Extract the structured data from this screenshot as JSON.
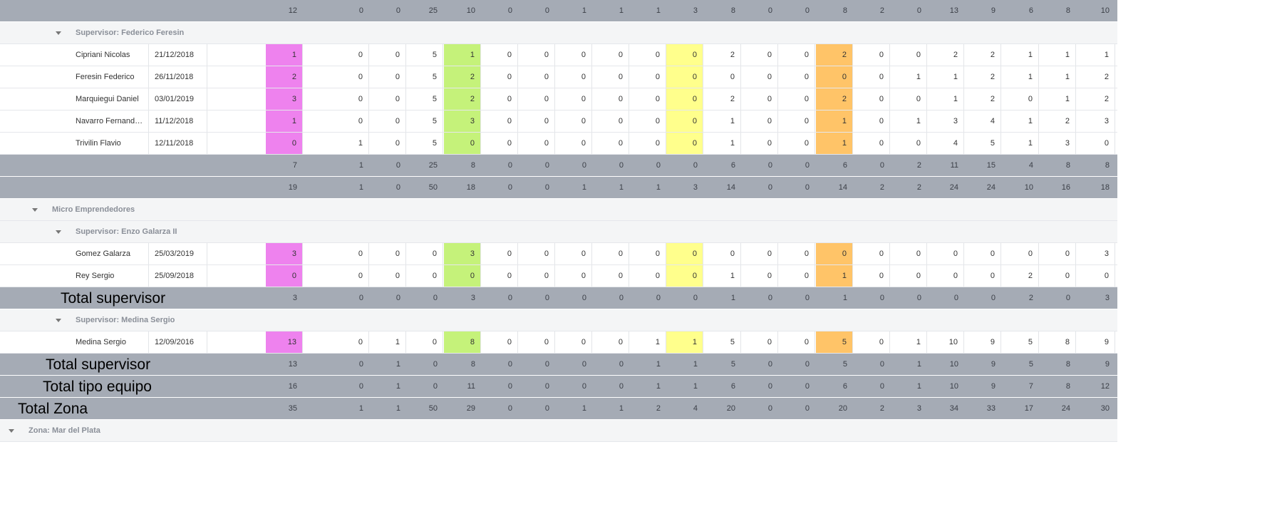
{
  "rows": [
    {
      "type": "total",
      "values": [
        "12",
        "0",
        "0",
        "25",
        "10",
        "0",
        "0",
        "1",
        "1",
        "1",
        "3",
        "8",
        "0",
        "0",
        "8",
        "2",
        "0",
        "13",
        "9",
        "6",
        "8",
        "10"
      ]
    },
    {
      "type": "group",
      "level": 2,
      "label": "Supervisor: Federico Feresin"
    },
    {
      "type": "data",
      "name": "Cipriani Nicolas",
      "date": "21/12/2018",
      "values": [
        "1",
        "0",
        "0",
        "5",
        "1",
        "0",
        "0",
        "0",
        "0",
        "0",
        "0",
        "2",
        "0",
        "0",
        "2",
        "0",
        "0",
        "2",
        "2",
        "1",
        "1",
        "1"
      ]
    },
    {
      "type": "data",
      "name": "Feresin Federico",
      "date": "26/11/2018",
      "values": [
        "2",
        "0",
        "0",
        "5",
        "2",
        "0",
        "0",
        "0",
        "0",
        "0",
        "0",
        "0",
        "0",
        "0",
        "0",
        "0",
        "1",
        "1",
        "2",
        "1",
        "1",
        "2"
      ]
    },
    {
      "type": "data",
      "name": "Marquiegui Daniel",
      "date": "03/01/2019",
      "values": [
        "3",
        "0",
        "0",
        "5",
        "2",
        "0",
        "0",
        "0",
        "0",
        "0",
        "0",
        "2",
        "0",
        "0",
        "2",
        "0",
        "0",
        "1",
        "2",
        "0",
        "1",
        "2"
      ]
    },
    {
      "type": "data",
      "name": "Navarro Fernando F...",
      "date": "11/12/2018",
      "values": [
        "1",
        "0",
        "0",
        "5",
        "3",
        "0",
        "0",
        "0",
        "0",
        "0",
        "0",
        "1",
        "0",
        "0",
        "1",
        "0",
        "1",
        "3",
        "4",
        "1",
        "2",
        "3"
      ]
    },
    {
      "type": "data",
      "name": "Trivilin Flavio",
      "date": "12/11/2018",
      "values": [
        "0",
        "1",
        "0",
        "5",
        "0",
        "0",
        "0",
        "0",
        "0",
        "0",
        "0",
        "1",
        "0",
        "0",
        "1",
        "0",
        "0",
        "4",
        "5",
        "1",
        "3",
        "0"
      ]
    },
    {
      "type": "total",
      "values": [
        "7",
        "1",
        "0",
        "25",
        "8",
        "0",
        "0",
        "0",
        "0",
        "0",
        "0",
        "6",
        "0",
        "0",
        "6",
        "0",
        "2",
        "11",
        "15",
        "4",
        "8",
        "8"
      ]
    },
    {
      "type": "total",
      "values": [
        "19",
        "1",
        "0",
        "50",
        "18",
        "0",
        "0",
        "1",
        "1",
        "1",
        "3",
        "14",
        "0",
        "0",
        "14",
        "2",
        "2",
        "24",
        "24",
        "10",
        "16",
        "18"
      ]
    },
    {
      "type": "group",
      "level": 1,
      "label": "Micro Emprendedores"
    },
    {
      "type": "group",
      "level": 2,
      "label": "Supervisor: Enzo Galarza II"
    },
    {
      "type": "data",
      "name": "Gomez Galarza",
      "date": "25/03/2019",
      "values": [
        "3",
        "0",
        "0",
        "0",
        "3",
        "0",
        "0",
        "0",
        "0",
        "0",
        "0",
        "0",
        "0",
        "0",
        "0",
        "0",
        "0",
        "0",
        "0",
        "0",
        "0",
        "3"
      ]
    },
    {
      "type": "data",
      "name": "Rey Sergio",
      "date": "25/09/2018",
      "values": [
        "0",
        "0",
        "0",
        "0",
        "0",
        "0",
        "0",
        "0",
        "0",
        "0",
        "0",
        "1",
        "0",
        "0",
        "1",
        "0",
        "0",
        "0",
        "0",
        "2",
        "0",
        "0"
      ]
    },
    {
      "type": "total",
      "overlay": "Total supervisor",
      "values": [
        "3",
        "0",
        "0",
        "0",
        "3",
        "0",
        "0",
        "0",
        "0",
        "0",
        "0",
        "1",
        "0",
        "0",
        "1",
        "0",
        "0",
        "0",
        "0",
        "2",
        "0",
        "3"
      ]
    },
    {
      "type": "group",
      "level": 2,
      "label": "Supervisor: Medina Sergio"
    },
    {
      "type": "data",
      "name": "Medina Sergio",
      "date": "12/09/2016",
      "values": [
        "13",
        "0",
        "1",
        "0",
        "8",
        "0",
        "0",
        "0",
        "0",
        "1",
        "1",
        "5",
        "0",
        "0",
        "5",
        "0",
        "1",
        "10",
        "9",
        "5",
        "8",
        "9"
      ]
    },
    {
      "type": "total",
      "overlay": "Total supervisor",
      "values": [
        "13",
        "0",
        "1",
        "0",
        "8",
        "0",
        "0",
        "0",
        "0",
        "1",
        "1",
        "5",
        "0",
        "0",
        "5",
        "0",
        "1",
        "10",
        "9",
        "5",
        "8",
        "9"
      ]
    },
    {
      "type": "total",
      "overlay": "Total tipo equipo",
      "values": [
        "16",
        "0",
        "1",
        "0",
        "11",
        "0",
        "0",
        "0",
        "0",
        "1",
        "1",
        "6",
        "0",
        "0",
        "6",
        "0",
        "1",
        "10",
        "9",
        "7",
        "8",
        "12"
      ]
    },
    {
      "type": "total",
      "overlay": "Total Zona",
      "values": [
        "35",
        "1",
        "1",
        "50",
        "29",
        "0",
        "0",
        "1",
        "1",
        "2",
        "4",
        "20",
        "0",
        "0",
        "20",
        "2",
        "3",
        "34",
        "33",
        "17",
        "24",
        "30"
      ]
    },
    {
      "type": "group",
      "level": 0,
      "label": "Zona: Mar del Plata"
    }
  ],
  "colors": {
    "col0": "#ee82ee",
    "col4": "#c5f27a",
    "col10": "#ffff8c",
    "col14": "#ffc468",
    "total_row": "#a5abb5",
    "group_row": "#f4f5f6"
  },
  "icons": {
    "group_toggle": "chevron-down-icon"
  }
}
